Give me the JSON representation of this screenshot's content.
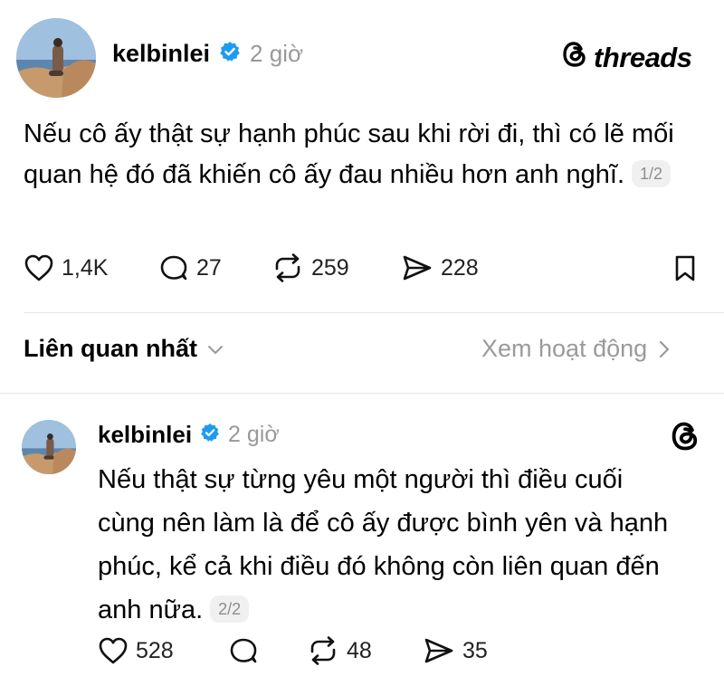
{
  "post": {
    "username": "kelbinlei",
    "time": "2 giờ",
    "brand": "threads",
    "text": "Nếu cô ấy thật sự hạnh phúc sau khi rời đi, thì có lẽ mối quan hệ đó đã khiến cô ấy đau nhiều hơn anh nghĩ.",
    "page": "1/2",
    "likes": "1,4K",
    "comments": "27",
    "reposts": "259",
    "shares": "228"
  },
  "sort_bar": {
    "label": "Liên quan nhất",
    "activity": "Xem hoạt động"
  },
  "reply": {
    "username": "kelbinlei",
    "time": "2 giờ",
    "text": "Nếu thật sự từng yêu một người thì điều cuối cùng nên làm là để cô ấy được bình yên và hạnh phúc, kể cả khi điều đó không còn liên quan đến anh nữa.",
    "page": "2/2",
    "likes": "528",
    "reposts": "48",
    "shares": "35"
  },
  "colors": {
    "verified": "#1d9bf0",
    "muted": "#999999",
    "divider": "#e6e6e6"
  },
  "icons": [
    "verified-badge-icon",
    "threads-logo-icon",
    "heart-icon",
    "comment-icon",
    "repost-icon",
    "share-icon",
    "bookmark-icon",
    "chevron-down-icon",
    "chevron-right-icon"
  ]
}
